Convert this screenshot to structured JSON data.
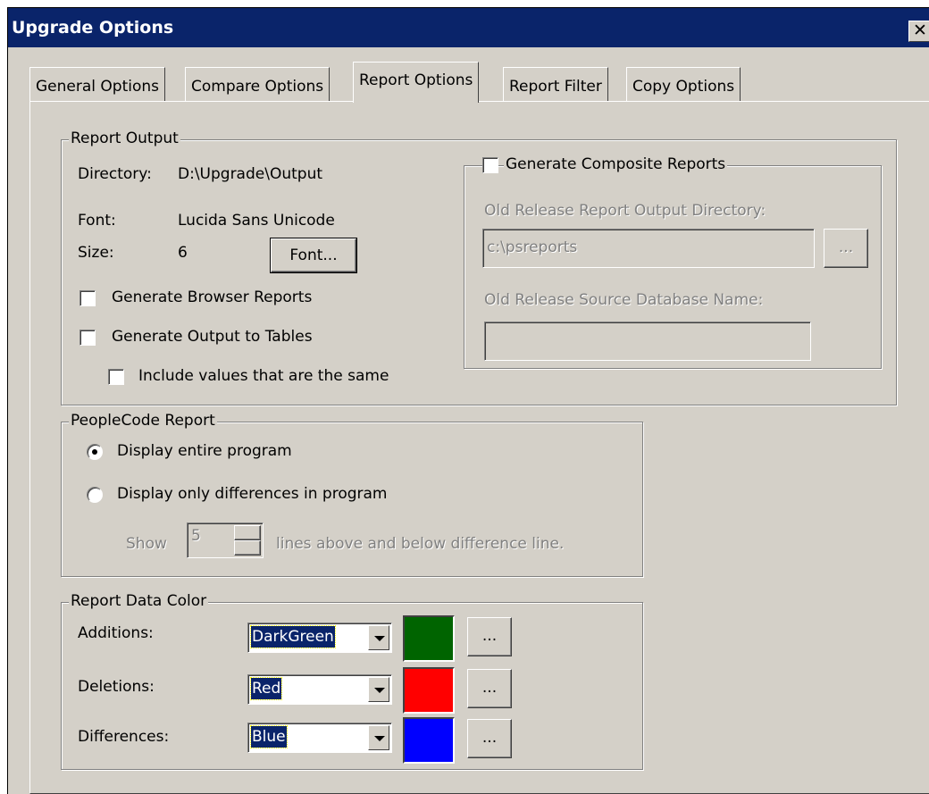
{
  "window": {
    "title": "Upgrade Options",
    "close_glyph": "✕"
  },
  "tabs": [
    {
      "label": "General Options"
    },
    {
      "label": "Compare Options"
    },
    {
      "label": "Report Options"
    },
    {
      "label": "Report Filter"
    },
    {
      "label": "Copy Options"
    }
  ],
  "active_tab": "Report Options",
  "report_output": {
    "legend": "Report Output",
    "directory_label": "Directory:",
    "directory_value": "D:\\Upgrade\\Output",
    "font_label": "Font:",
    "font_value": "Lucida Sans Unicode",
    "size_label": "Size:",
    "size_value": "6",
    "font_button": "Font...",
    "browser_reports_label": "Generate Browser Reports",
    "browser_reports_checked": false,
    "output_tables_label": "Generate Output to Tables",
    "output_tables_checked": false,
    "include_same_label": "Include values that are the same",
    "include_same_checked": false
  },
  "composite": {
    "legend": "Generate Composite Reports",
    "checked": false,
    "old_dir_label": "Old Release Report Output Directory:",
    "old_dir_value": "c:\\psreports",
    "browse_button": "...",
    "old_db_label": "Old Release Source Database Name:",
    "old_db_value": ""
  },
  "peoplecode": {
    "legend": "PeopleCode Report",
    "option_entire": "Display entire program",
    "option_diff": "Display only differences in program",
    "selected": "Display entire program",
    "show_label": "Show",
    "show_value": "5",
    "show_suffix": "lines above and below difference line."
  },
  "colors": {
    "legend": "Report Data Color",
    "rows": [
      {
        "label": "Additions:",
        "value": "DarkGreen",
        "swatch": "#006400",
        "button": "..."
      },
      {
        "label": "Deletions:",
        "value": "Red",
        "swatch": "#ff0000",
        "button": "..."
      },
      {
        "label": "Differences:",
        "value": "Blue",
        "swatch": "#0000ff",
        "button": "..."
      }
    ]
  }
}
